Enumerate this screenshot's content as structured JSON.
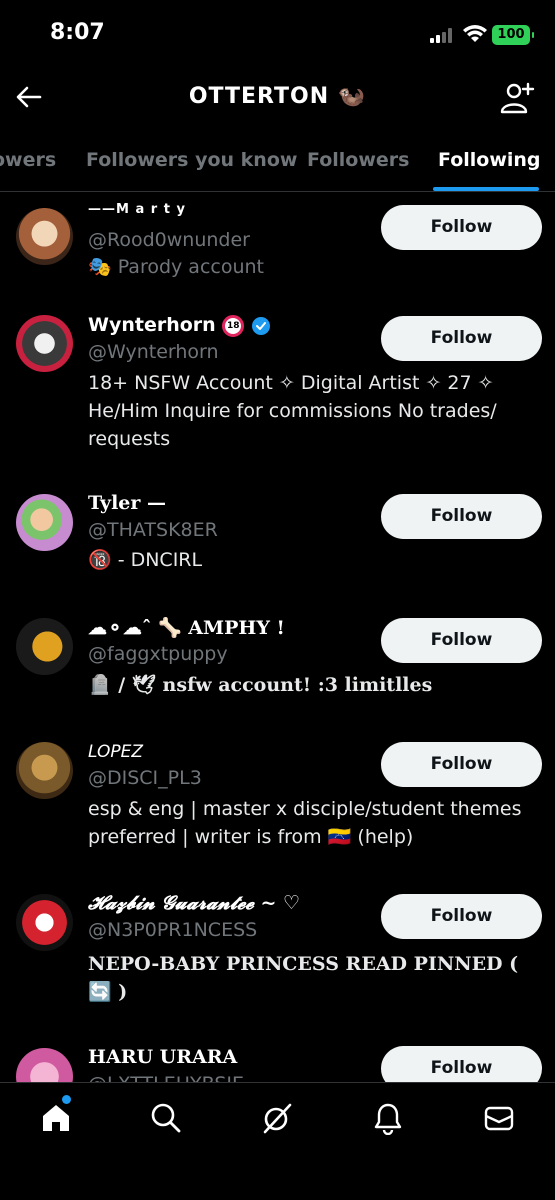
{
  "status": {
    "time": "8:07",
    "battery": "100"
  },
  "header": {
    "title": "OTTERTON 🦦"
  },
  "tabs": [
    {
      "label": "owers"
    },
    {
      "label": "Followers you know"
    },
    {
      "label": "Followers"
    },
    {
      "label": "Following"
    }
  ],
  "follow_label": "Follow",
  "users": [
    {
      "name": "——M a r t y",
      "handle": "@Rood0wnunder",
      "bio": "🎭 Parody account"
    },
    {
      "name": "Wynterhorn",
      "handle": "@Wynterhorn",
      "bio": "18+ NSFW Account ✧ Digital Artist ✧ 27 ✧ He/Him Inquire for commissions No trades/ requests"
    },
    {
      "name": "Tyler —",
      "handle": "@THATSK8ER",
      "bio": "🔞 - DNCIRL"
    },
    {
      "name": "☁︎⚬☁︎ˆ 🦴 AMPHY !",
      "handle": "@faggxtpuppy",
      "bio": "🪦 / 🕊 nsfw account! :3 limitlles"
    },
    {
      "name": "LOPEZ",
      "handle": "@DISCI_PL3",
      "bio": "esp & eng | master x disciple/student themes preferred | writer is from 🇻🇪 (help)"
    },
    {
      "name": "𝓗𝓪𝔃𝓫𝓲𝓷 𝓖𝓾𝓪𝓻𝓪𝓷𝓽𝓮𝓮 ~ ♡",
      "handle": "@N3P0PR1NCESS",
      "bio": "NEPO-BABY PRINCESS READ PINNED ( 🔄 )"
    },
    {
      "name": "HARU URARA",
      "handle": "@LXTTLEHYBSIE",
      "bio": ""
    }
  ],
  "nav": [
    "home-icon",
    "search-icon",
    "grok-icon",
    "notifications-icon",
    "messages-icon"
  ]
}
